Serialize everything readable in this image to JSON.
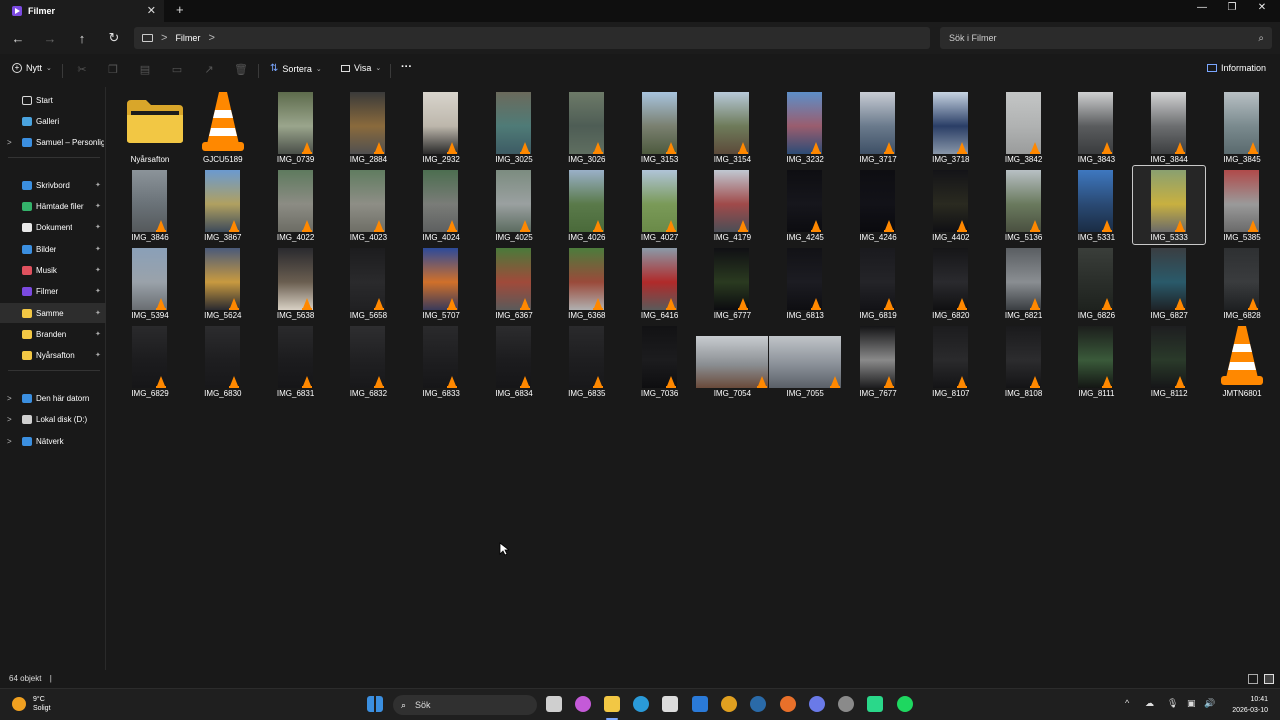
{
  "window": {
    "tab_title": "Filmer",
    "tab_close": "✕",
    "new_tab": "+",
    "minimize": "—",
    "maximize": "❐",
    "close": "✕"
  },
  "nav": {
    "back": "←",
    "forward": "→",
    "up": "↑",
    "refresh": "↻",
    "breadcrumb": "Filmer",
    "chevron": ">",
    "search_placeholder": "Sök i Filmer",
    "search_icon": "⌕"
  },
  "commandbar": {
    "new_label": "Nytt",
    "sort_label": "Sortera",
    "view_label": "Visa",
    "more": "···",
    "info_label": "Information"
  },
  "sidebar": {
    "items": [
      {
        "label": "Start",
        "icon": "home-icon",
        "color": "#d9d9d9",
        "pinned": false,
        "chevron": false
      },
      {
        "label": "Galleri",
        "icon": "gallery-icon",
        "color": "#4aa3df",
        "pinned": false,
        "chevron": false
      },
      {
        "label": "Samuel – Personlig",
        "icon": "onedrive-icon",
        "color": "#3b8fe0",
        "pinned": false,
        "chevron": true
      },
      {
        "label": "Skrivbord",
        "icon": "desktop-icon",
        "color": "#3b8fe0",
        "pinned": true,
        "chevron": false
      },
      {
        "label": "Hämtade filer",
        "icon": "download-icon",
        "color": "#34b36b",
        "pinned": true,
        "chevron": false
      },
      {
        "label": "Dokument",
        "icon": "document-icon",
        "color": "#e8e8e8",
        "pinned": true,
        "chevron": false
      },
      {
        "label": "Bilder",
        "icon": "pictures-icon",
        "color": "#3b8fe0",
        "pinned": true,
        "chevron": false
      },
      {
        "label": "Musik",
        "icon": "music-icon",
        "color": "#e0525f",
        "pinned": true,
        "chevron": false
      },
      {
        "label": "Filmer",
        "icon": "videos-icon",
        "color": "#7b4ae0",
        "pinned": true,
        "chevron": false
      },
      {
        "label": "Samme",
        "icon": "folder-icon",
        "color": "#f2c744",
        "pinned": true,
        "chevron": false,
        "selected": true
      },
      {
        "label": "Branden",
        "icon": "folder-icon",
        "color": "#f2c744",
        "pinned": true,
        "chevron": false
      },
      {
        "label": "Nyårsafton",
        "icon": "folder-icon",
        "color": "#f2c744",
        "pinned": true,
        "chevron": false
      },
      {
        "label": "Den här datorn",
        "icon": "pc-icon",
        "color": "#3b8fe0",
        "pinned": false,
        "chevron": true
      },
      {
        "label": "Lokal disk (D:)",
        "icon": "drive-icon",
        "color": "#cfcfcf",
        "pinned": false,
        "chevron": true
      },
      {
        "label": "Nätverk",
        "icon": "network-icon",
        "color": "#3b8fe0",
        "pinned": false,
        "chevron": true
      }
    ],
    "pin_glyph": "📌",
    "chevron_glyph": ">"
  },
  "files": [
    {
      "name": "Nyårsafton",
      "kind": "folder"
    },
    {
      "name": "GJCU5189",
      "kind": "vlc"
    },
    {
      "name": "IMG_0739",
      "kind": "video",
      "c": [
        "#5d6b4c",
        "#9aa58c",
        "#4a4f49"
      ]
    },
    {
      "name": "IMG_2884",
      "kind": "video",
      "c": [
        "#3a3a3a",
        "#8a6a3c",
        "#505050"
      ]
    },
    {
      "name": "IMG_2932",
      "kind": "video",
      "c": [
        "#d8d4cc",
        "#bdb7ac",
        "#2a2a2a"
      ]
    },
    {
      "name": "IMG_3025",
      "kind": "video",
      "c": [
        "#6b6a5c",
        "#4f7b77",
        "#3d5b64"
      ]
    },
    {
      "name": "IMG_3026",
      "kind": "video",
      "c": [
        "#6d7a68",
        "#4e5d55",
        "#5f6e60"
      ]
    },
    {
      "name": "IMG_3153",
      "kind": "video",
      "c": [
        "#a8c4de",
        "#7a8070",
        "#4d5a3e"
      ]
    },
    {
      "name": "IMG_3154",
      "kind": "video",
      "c": [
        "#b7c9d9",
        "#6e7b5a",
        "#5c4a3a"
      ]
    },
    {
      "name": "IMG_3232",
      "kind": "video",
      "c": [
        "#5d8fc8",
        "#9a5d6e",
        "#2c4c76"
      ]
    },
    {
      "name": "IMG_3717",
      "kind": "video",
      "c": [
        "#c8ccd4",
        "#6a7a8c",
        "#3e5066"
      ]
    },
    {
      "name": "IMG_3718",
      "kind": "video",
      "c": [
        "#c7d4e2",
        "#2a3e66",
        "#8896a8"
      ]
    },
    {
      "name": "IMG_3842",
      "kind": "video",
      "c": [
        "#c4c6c6",
        "#b0b2b2",
        "#9a9c9c"
      ]
    },
    {
      "name": "IMG_3843",
      "kind": "video",
      "c": [
        "#cfd0d1",
        "#5a5c5e",
        "#3a3c3e"
      ]
    },
    {
      "name": "IMG_3844",
      "kind": "video",
      "c": [
        "#d2d3d4",
        "#6c6e70",
        "#3c3e40"
      ]
    },
    {
      "name": "IMG_3845",
      "kind": "video",
      "c": [
        "#b8c0c4",
        "#7a8a8e",
        "#5a6a6e"
      ]
    },
    {
      "name": "IMG_3846",
      "kind": "video",
      "c": [
        "#8c949a",
        "#6a7278",
        "#55595c"
      ]
    },
    {
      "name": "IMG_3867",
      "kind": "video",
      "c": [
        "#6b9ad0",
        "#b0a060",
        "#3d4a5a"
      ]
    },
    {
      "name": "IMG_4022",
      "kind": "video",
      "c": [
        "#5e7a5e",
        "#8c8c84",
        "#6c6c64"
      ]
    },
    {
      "name": "IMG_4023",
      "kind": "video",
      "c": [
        "#607c60",
        "#8e8e86",
        "#6e6e66"
      ]
    },
    {
      "name": "IMG_4024",
      "kind": "video",
      "c": [
        "#4c6e50",
        "#7a7c78",
        "#5e6060"
      ]
    },
    {
      "name": "IMG_4025",
      "kind": "video",
      "c": [
        "#7c8c80",
        "#9aa0a0",
        "#5c6c60"
      ]
    },
    {
      "name": "IMG_4026",
      "kind": "video",
      "c": [
        "#9ab0c8",
        "#5a7a4a",
        "#4a6a3a"
      ]
    },
    {
      "name": "IMG_4027",
      "kind": "video",
      "c": [
        "#b0c4d8",
        "#7a9a58",
        "#6a8a48"
      ]
    },
    {
      "name": "IMG_4179",
      "kind": "video",
      "c": [
        "#c0c8d2",
        "#a04a4a",
        "#4a4e56"
      ]
    },
    {
      "name": "IMG_4245",
      "kind": "video",
      "c": [
        "#0e0e12",
        "#16161c",
        "#0c0c10"
      ]
    },
    {
      "name": "IMG_4246",
      "kind": "video",
      "c": [
        "#0e0e12",
        "#121218",
        "#0a0a0e"
      ]
    },
    {
      "name": "IMG_4402",
      "kind": "video",
      "c": [
        "#141418",
        "#2a2a20",
        "#101014"
      ]
    },
    {
      "name": "IMG_5136",
      "kind": "video",
      "c": [
        "#b8c0c4",
        "#6a7a5e",
        "#4a5040"
      ]
    },
    {
      "name": "IMG_5331",
      "kind": "video",
      "c": [
        "#3e78c0",
        "#2a4a74",
        "#1a2c44"
      ]
    },
    {
      "name": "IMG_5333",
      "kind": "video",
      "c": [
        "#8aa070",
        "#c8b040",
        "#6a6a6a"
      ],
      "selected": true
    },
    {
      "name": "IMG_5385",
      "kind": "video",
      "c": [
        "#b04a4a",
        "#9a9a9a",
        "#6a6a6a"
      ]
    },
    {
      "name": "IMG_5394",
      "kind": "video",
      "c": [
        "#8aa0b8",
        "#9aa2aa",
        "#6a6e72"
      ]
    },
    {
      "name": "IMG_5624",
      "kind": "video",
      "c": [
        "#4a5a7a",
        "#c89a40",
        "#2a2a30"
      ]
    },
    {
      "name": "IMG_5638",
      "kind": "video",
      "c": [
        "#2a2a2e",
        "#6a5e50",
        "#d8d0c4"
      ]
    },
    {
      "name": "IMG_5658",
      "kind": "video",
      "c": [
        "#1c1c1e",
        "#2a2a2c",
        "#202022"
      ]
    },
    {
      "name": "IMG_5707",
      "kind": "video",
      "c": [
        "#2c4a9a",
        "#d0702a",
        "#3a3a5a"
      ]
    },
    {
      "name": "IMG_6367",
      "kind": "video",
      "c": [
        "#4a7a3a",
        "#a04a3a",
        "#5a5a5a"
      ]
    },
    {
      "name": "IMG_6368",
      "kind": "video",
      "c": [
        "#4c7c3c",
        "#9a4a3a",
        "#b0b0b0"
      ]
    },
    {
      "name": "IMG_6416",
      "kind": "video",
      "c": [
        "#8a9aa8",
        "#b02a2a",
        "#5a5a5a"
      ]
    },
    {
      "name": "IMG_6777",
      "kind": "video",
      "c": [
        "#101014",
        "#2a3a20",
        "#0c0c10"
      ]
    },
    {
      "name": "IMG_6813",
      "kind": "video",
      "c": [
        "#121216",
        "#1c1c22",
        "#0e0e12"
      ]
    },
    {
      "name": "IMG_6819",
      "kind": "video",
      "c": [
        "#1a1a1e",
        "#242428",
        "#121216"
      ]
    },
    {
      "name": "IMG_6820",
      "kind": "video",
      "c": [
        "#161618",
        "#2a2a2e",
        "#101012"
      ]
    },
    {
      "name": "IMG_6821",
      "kind": "video",
      "c": [
        "#5a5e62",
        "#8a8e92",
        "#3a3e42"
      ]
    },
    {
      "name": "IMG_6826",
      "kind": "video",
      "c": [
        "#3a3e3a",
        "#2a2e2a",
        "#1e221e"
      ]
    },
    {
      "name": "IMG_6827",
      "kind": "video",
      "c": [
        "#3a3e42",
        "#2a5a6a",
        "#1e2226"
      ]
    },
    {
      "name": "IMG_6828",
      "kind": "video",
      "c": [
        "#2e3032",
        "#3a3c3e",
        "#1e2022"
      ]
    },
    {
      "name": "IMG_6829",
      "kind": "video",
      "c": [
        "#2a2a2c",
        "#1c1c1e",
        "#161618"
      ]
    },
    {
      "name": "IMG_6830",
      "kind": "video",
      "c": [
        "#2c2c2e",
        "#1e1e20",
        "#18181a"
      ]
    },
    {
      "name": "IMG_6831",
      "kind": "video",
      "c": [
        "#2a2a2c",
        "#1c1c1e",
        "#161618"
      ]
    },
    {
      "name": "IMG_6832",
      "kind": "video",
      "c": [
        "#2e2e30",
        "#202022",
        "#18181a"
      ]
    },
    {
      "name": "IMG_6833",
      "kind": "video",
      "c": [
        "#2a2a2c",
        "#1e1e20",
        "#161618"
      ]
    },
    {
      "name": "IMG_6834",
      "kind": "video",
      "c": [
        "#2c2c2e",
        "#1c1c1e",
        "#161618"
      ]
    },
    {
      "name": "IMG_6835",
      "kind": "video",
      "c": [
        "#2a2a2c",
        "#1e1e20",
        "#18181a"
      ]
    },
    {
      "name": "IMG_7036",
      "kind": "video",
      "c": [
        "#121214",
        "#1c1c1e",
        "#0e0e10"
      ]
    },
    {
      "name": "IMG_7054",
      "kind": "video-wide",
      "c": [
        "#c8ccd0",
        "#8a8e92",
        "#6a4a3a"
      ]
    },
    {
      "name": "IMG_7055",
      "kind": "video-wide",
      "c": [
        "#c0c4c8",
        "#8a9098",
        "#5a6068"
      ]
    },
    {
      "name": "IMG_7677",
      "kind": "video",
      "c": [
        "#141416",
        "#8a8a8a",
        "#1c1c1e"
      ]
    },
    {
      "name": "IMG_8107",
      "kind": "video",
      "c": [
        "#1c1c1e",
        "#2a2a2c",
        "#141416"
      ]
    },
    {
      "name": "IMG_8108",
      "kind": "video",
      "c": [
        "#1a1a1c",
        "#2c2c2e",
        "#141416"
      ]
    },
    {
      "name": "IMG_8111",
      "kind": "video",
      "c": [
        "#1c1e1c",
        "#3a5a3a",
        "#141614"
      ]
    },
    {
      "name": "IMG_8112",
      "kind": "video",
      "c": [
        "#1e1e20",
        "#2a3a2a",
        "#161618"
      ]
    },
    {
      "name": "JMTN6801",
      "kind": "vlc"
    }
  ],
  "status": {
    "count": "64 objekt",
    "separator": "|"
  },
  "taskbar": {
    "temp": "9°C",
    "weather": "Soligt",
    "search_placeholder": "Sök",
    "search_icon": "⌕",
    "time": "10:41",
    "date": "2026-03-10",
    "tray_chevron": "^",
    "apps": [
      {
        "name": "start-icon",
        "color": "#3b8fe0"
      },
      {
        "name": "taskview-icon",
        "color": "#cfcfcf"
      },
      {
        "name": "copilot-icon",
        "color": "#c45ad8"
      },
      {
        "name": "file-explorer-icon",
        "color": "#f2c744"
      },
      {
        "name": "edge-icon",
        "color": "#2a9ad8"
      },
      {
        "name": "store-icon",
        "color": "#dcdcdc"
      },
      {
        "name": "outlook-icon",
        "color": "#2a7ad8"
      },
      {
        "name": "chrome-icon",
        "color": "#e0a020"
      },
      {
        "name": "steam-icon",
        "color": "#2a6aa8"
      },
      {
        "name": "firefox-icon",
        "color": "#e8702a"
      },
      {
        "name": "discord-icon",
        "color": "#6a7ae8"
      },
      {
        "name": "app-icon",
        "color": "#8a8a8a"
      },
      {
        "name": "app2-icon",
        "color": "#2ad88a"
      },
      {
        "name": "spotify-icon",
        "color": "#1ed760"
      }
    ]
  }
}
